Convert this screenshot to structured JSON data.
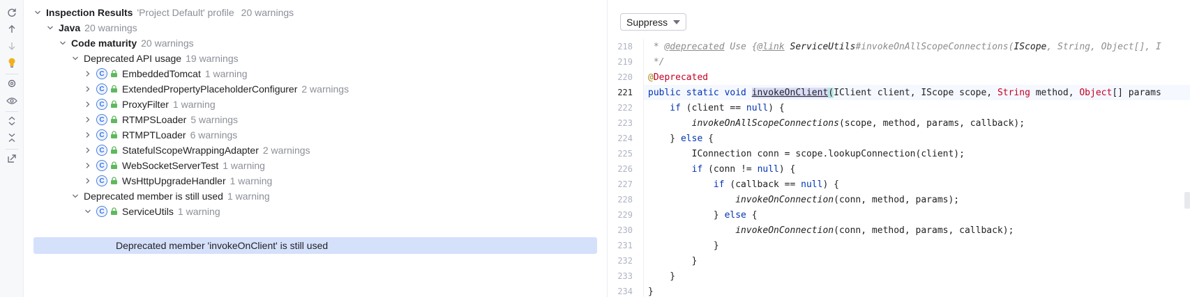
{
  "toolbar": {
    "icons": [
      "rerun-icon",
      "up-arrow-icon",
      "down-arrow-icon",
      "lightbulb-icon",
      "settings-icon",
      "eye-icon",
      "expand-all-icon",
      "collapse-all-icon",
      "export-icon"
    ]
  },
  "tree": {
    "root": {
      "label": "Inspection Results",
      "profile": "'Project Default' profile",
      "count": "20 warnings"
    },
    "java": {
      "label": "Java",
      "count": "20 warnings"
    },
    "code_maturity": {
      "label": "Code maturity",
      "count": "20 warnings"
    },
    "deprecated_api": {
      "label": "Deprecated API usage",
      "count": "19 warnings"
    },
    "classes": [
      {
        "label": "EmbeddedTomcat",
        "count": "1 warning"
      },
      {
        "label": "ExtendedPropertyPlaceholderConfigurer",
        "count": "2 warnings"
      },
      {
        "label": "ProxyFilter",
        "count": "1 warning"
      },
      {
        "label": "RTMPSLoader",
        "count": "5 warnings"
      },
      {
        "label": "RTMPTLoader",
        "count": "6 warnings"
      },
      {
        "label": "StatefulScopeWrappingAdapter",
        "count": "2 warnings"
      },
      {
        "label": "WebSocketServerTest",
        "count": "1 warning"
      },
      {
        "label": "WsHttpUpgradeHandler",
        "count": "1 warning"
      }
    ],
    "deprecated_member": {
      "label": "Deprecated member is still used",
      "count": "1 warning"
    },
    "service_utils": {
      "label": "ServiceUtils",
      "count": "1 warning"
    },
    "problem": {
      "label": "Deprecated member 'invokeOnClient' is still used"
    },
    "class_icon_glyph": "C"
  },
  "editor": {
    "suppress_label": "Suppress",
    "line_numbers": [
      "218",
      "219",
      "220",
      "221",
      "222",
      "223",
      "224",
      "225",
      "226",
      "227",
      "228",
      "229",
      "230",
      "231",
      "232",
      "233",
      "234"
    ],
    "colors": {
      "keyword": "#0033b3",
      "string_type": "#c40022",
      "annotation": "#9e880d",
      "comment": "#8c8c8c",
      "selection": "#d5e1fb"
    },
    "code": {
      "l218_a": " * ",
      "l218_b": "@deprecated",
      "l218_c": " Use {",
      "l218_d": "@link",
      "l218_e": " ServiceUtils",
      "l218_f": "#invokeOnAllScopeConnections(",
      "l218_g": "IScope",
      "l218_h": ", String, Object[], I",
      "l219": " */",
      "l220_a": "@",
      "l220_b": "Deprecated",
      "l221_a": "public static void ",
      "l221_b": "invokeOnClient",
      "l221_c": "(",
      "l221_d": "IClient client, IScope scope, ",
      "l221_e": "String",
      "l221_f": " method, ",
      "l221_g": "Object",
      "l221_h": "[] params",
      "l222_a": "    if",
      "l222_b": " (client == ",
      "l222_c": "null",
      "l222_d": ") {",
      "l223_a": "        ",
      "l223_b": "invokeOnAllScopeConnections",
      "l223_c": "(scope, method, params, callback);",
      "l224_a": "    } ",
      "l224_b": "else",
      "l224_c": " {",
      "l225": "        IConnection conn = scope.lookupConnection(client);",
      "l226_a": "        if",
      "l226_b": " (conn != ",
      "l226_c": "null",
      "l226_d": ") {",
      "l227_a": "            if",
      "l227_b": " (callback == ",
      "l227_c": "null",
      "l227_d": ") {",
      "l228_a": "                ",
      "l228_b": "invokeOnConnection",
      "l228_c": "(conn, method, params);",
      "l229_a": "            } ",
      "l229_b": "else",
      "l229_c": " {",
      "l230_a": "                ",
      "l230_b": "invokeOnConnection",
      "l230_c": "(conn, method, params, callback);",
      "l231": "            }",
      "l232": "        }",
      "l233": "    }",
      "l234": "}"
    }
  }
}
